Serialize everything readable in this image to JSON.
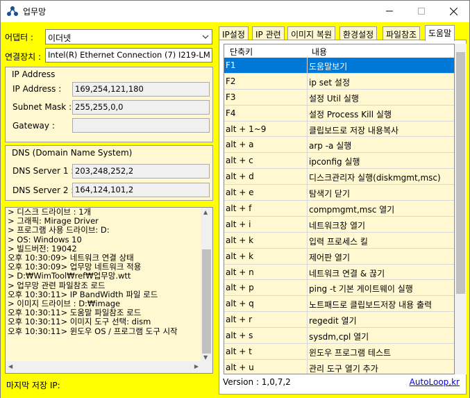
{
  "window": {
    "title": "업무망"
  },
  "adapter": {
    "label": "어댑터 :",
    "value": "이더넷"
  },
  "device": {
    "label": "연결장치 :",
    "value": "Intel(R) Ethernet Connection (7) I219-LM"
  },
  "ip_group": {
    "title": "IP Address",
    "ip_label": "IP Address :",
    "ip_value": "169,254,121,180",
    "mask_label": "Subnet Mask :",
    "mask_value": "255,255,0,0",
    "gw_label": "Gateway :",
    "gw_value": ""
  },
  "dns_group": {
    "title": "DNS (Domain Name System)",
    "dns1_label": "DNS Server 1 :",
    "dns1_value": "203,248,252,2",
    "dns2_label": "DNS Server 2 :",
    "dns2_value": "164,124,101,2"
  },
  "log": [
    "> 디스크 드라이브 : 1개",
    "> 그래픽: Mirage Driver",
    "> 프로그램 사용 드라이브: D:",
    "> OS: Windows 10",
    "> 빌드버전: 19042",
    "오후 10:30:09> 네트워크 연결 상태",
    "오후 10:30:09> 업무망 네트워크 적용",
    "> D:₩WimTool₩ref₩업무망.wtt",
    "> 업무망 관련 파일참조 로드",
    "오후 10:30:11> IP BandWidth 파일 로드",
    "> 이미지 드라이브 : D:₩image",
    "오후 10:30:11> 도움말 파일참조 로드",
    "오후 10:30:11> 이미지 도구 선택: dism",
    "오후 10:30:11> 윈도우 OS / 프로그램 도구 시작"
  ],
  "footer_left": {
    "label": "마지막 저장 IP:"
  },
  "tabs": [
    "IP설정",
    "IP 관련",
    "이미지 복원",
    "환경설정",
    "파일참조",
    "도움말"
  ],
  "help_table": {
    "headers": [
      "단축키",
      "내용"
    ],
    "rows": [
      [
        "F1",
        "도움말보기"
      ],
      [
        "F2",
        "ip set 설정"
      ],
      [
        "F3",
        "설정 Util 실행"
      ],
      [
        "F4",
        "설정 Process Kill 실행"
      ],
      [
        "alt + 1~9",
        "클립보드로 저장 내용복사"
      ],
      [
        "alt + a",
        "arp -a 실행"
      ],
      [
        "alt + c",
        "ipconfig 실행"
      ],
      [
        "alt + d",
        "디스크관리자 실행(diskmgmt,msc)"
      ],
      [
        "alt + e",
        "탐색기 닫기"
      ],
      [
        "alt + f",
        "compmgmt,msc 열기"
      ],
      [
        "alt + i",
        "네트워크창 열기"
      ],
      [
        "alt + k",
        "입력 프로세스 킬"
      ],
      [
        "alt + k",
        "제어판 열기"
      ],
      [
        "alt + n",
        "네트워크 연결 & 끊기"
      ],
      [
        "alt + p",
        "ping -t 기본 게이트웨이 실행"
      ],
      [
        "alt + q",
        "노트패드로 클립보드저장 내용 출력"
      ],
      [
        "alt + r",
        "regedit 열기"
      ],
      [
        "alt + s",
        "sysdm,cpl 열기"
      ],
      [
        "alt + t",
        "윈도우 프로그램 테스트"
      ],
      [
        "alt + u",
        "관리 도구 열기 추가"
      ]
    ]
  },
  "version": "Version : 1,0,7,2",
  "link": "AutoLoop,kr",
  "colors": {
    "panel": "#ffff00",
    "field_bg": "#fff8d0",
    "selection": "#0078d7"
  }
}
